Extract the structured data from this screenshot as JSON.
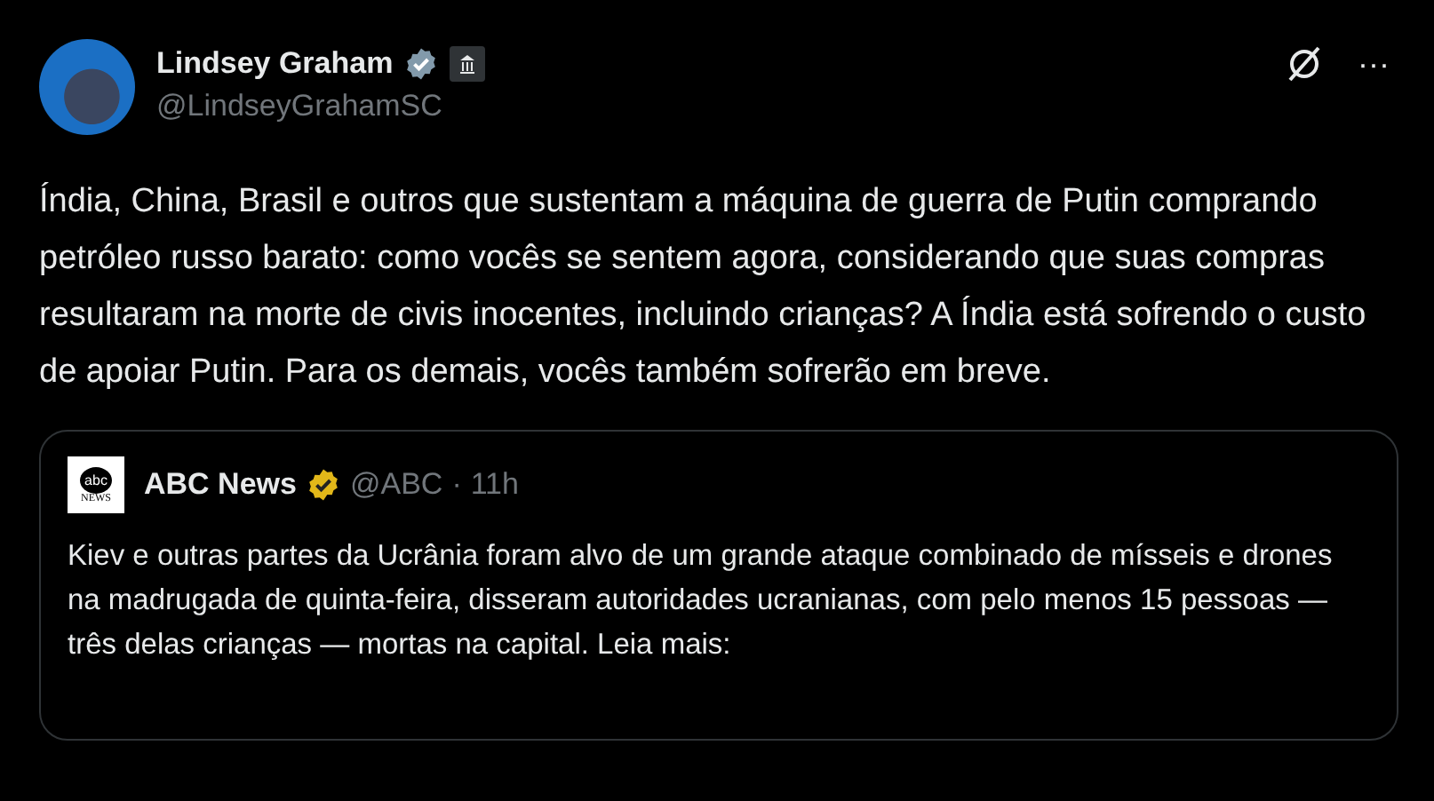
{
  "author": {
    "name": "Lindsey Graham",
    "verified": true,
    "handle": "@LindseyGrahamSC"
  },
  "text": "Índia, China, Brasil e outros que sustentam a máquina de guerra de Putin comprando petróleo russo barato: como vocês se sentem agora, considerando que suas compras resultaram na morte de civis inocentes, incluindo crianças? A Índia está sofrendo o custo de apoiar Putin. Para os demais, vocês também sofrerão em breve.",
  "quote": {
    "logo_top": "abc",
    "logo_bottom": "NEWS",
    "name": "ABC News",
    "verified": true,
    "handle": "@ABC",
    "separator": "·",
    "time": "11h",
    "text": "Kiev e outras partes da Ucrânia foram alvo de um grande ataque combinado de mísseis e drones na madrugada de quinta-feira, disseram autoridades ucranianas, com pelo menos 15 pessoas — três delas crianças — mortas na capital. Leia mais:"
  },
  "more_button": "···"
}
